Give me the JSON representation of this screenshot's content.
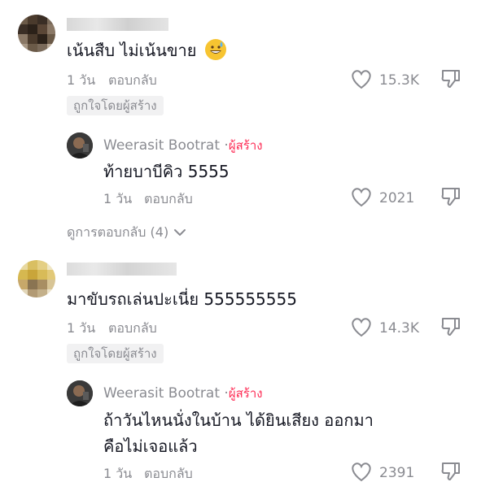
{
  "comments": [
    {
      "text": "เน้นสืบ ไม่เน้นขาย",
      "emoji": "grinning-sweat-emoji",
      "time": "1 วัน",
      "reply_label": "ตอบกลับ",
      "likes": "15.3K",
      "badge": "ถูกใจโดยผู้สร้าง",
      "reply": {
        "author": "Weerasit Bootrat",
        "separator": "·",
        "creator_label": "ผู้สร้าง",
        "text": "ท้ายบาบีคิว 5555",
        "time": "1 วัน",
        "reply_label": "ตอบกลับ",
        "likes": "2021"
      },
      "view_replies": "ดูการตอบกลับ (4)"
    },
    {
      "text": "มาขับรถเล่นปะเนี่ย 555555555",
      "time": "1 วัน",
      "reply_label": "ตอบกลับ",
      "likes": "14.3K",
      "badge": "ถูกใจโดยผู้สร้าง",
      "reply": {
        "author": "Weerasit Bootrat",
        "separator": "·",
        "creator_label": "ผู้สร้าง",
        "text_line1": "ถ้าวันไหนนั่งในบ้าน ได้ยินเสียง ออกมา",
        "text_line2": "คือไม่เจอแล้ว",
        "time": "1 วัน",
        "reply_label": "ตอบกลับ",
        "likes": "2391"
      }
    }
  ],
  "colors": {
    "accent": "#fe2c55",
    "muted": "#8a8b91",
    "text": "#161823",
    "badge_bg": "#f1f1f2"
  },
  "icons": [
    "heart-icon",
    "dislike-icon",
    "chevron-down-icon"
  ]
}
